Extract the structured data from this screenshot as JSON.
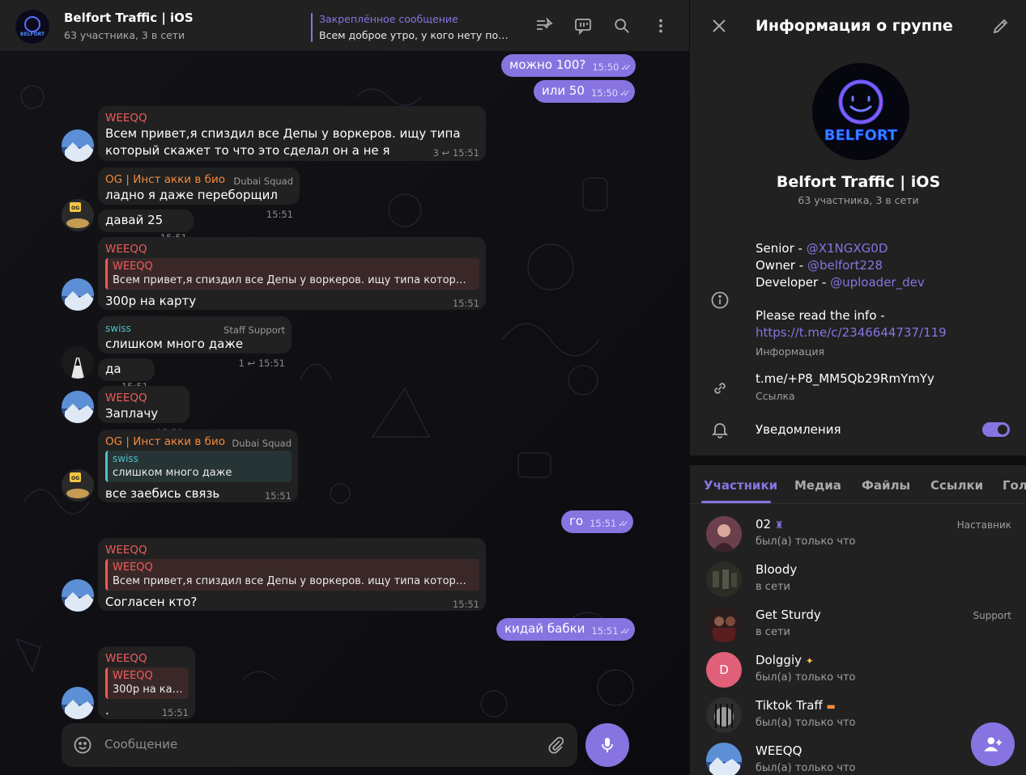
{
  "chat": {
    "title": "Belfort Traffic | iOS",
    "subtitle": "63 участника, 3 в сети",
    "pinned_label": "Закреплённое сообщение",
    "pinned_text": "Всем доброе утро, у кого нету подп...",
    "composer_placeholder": "Сообщение"
  },
  "messages": [
    {
      "text": "можно 100?",
      "time": "15:50"
    },
    {
      "text": "или 50",
      "time": "15:50"
    },
    {
      "sender": "WEEQQ",
      "text1": "Всем привет,я спиздил все Депы у воркеров. ищу типа",
      "text2": "который скажет то что это сделал он а не я",
      "replies": "3",
      "time": "15:51"
    },
    {
      "sender": "OG | Инст акки в био",
      "tag": "Dubai Squad",
      "text": "ладно я даже переборщил",
      "time": "15:51"
    },
    {
      "text": "давай 25",
      "time": "15:51"
    },
    {
      "sender": "WEEQQ",
      "reply_name": "WEEQQ",
      "reply_text": "Всем привет,я спиздил все Депы у воркеров. ищу типа который ск...",
      "text": "300р на карту",
      "time": "15:51"
    },
    {
      "sender": "swiss",
      "tag": "Staff Support",
      "text": "слишком много даже",
      "replies": "1",
      "time": "15:51"
    },
    {
      "text": "да",
      "time": "15:51"
    },
    {
      "sender": "WEEQQ",
      "text": "Заплачу",
      "time": "15:51"
    },
    {
      "sender": "OG | Инст акки в био",
      "tag": "Dubai Squad",
      "reply_name": "swiss",
      "reply_text": "слишком много даже",
      "text": "все заебись связь",
      "time": "15:51"
    },
    {
      "text": "го",
      "time": "15:51"
    },
    {
      "sender": "WEEQQ",
      "reply_name": "WEEQQ",
      "reply_text": "Всем привет,я спиздил все Депы у воркеров. ищу типа который ск...",
      "text": "Согласен кто?",
      "time": "15:51"
    },
    {
      "text": "кидай бабки",
      "time": "15:51"
    },
    {
      "sender": "WEEQQ",
      "reply_name": "WEEQQ",
      "reply_text": "300р на карту",
      "text": ".",
      "time": "15:51"
    }
  ],
  "info": {
    "title": "Информация о группе",
    "group_name": "Belfort Traffic | iOS",
    "group_sub": "63 участника, 3 в сети",
    "avatar_text": "BELFORT",
    "senior_label": "Senior - ",
    "senior_link": "@X1NGXG0D",
    "owner_label": "Owner - ",
    "owner_link": "@belfort228",
    "dev_label": "Developer - ",
    "dev_link": "@uploader_dev",
    "please": "Please read the info -",
    "info_link": "https://t.me/c/2346644737/119",
    "info_caption": "Информация",
    "invite": "t.me/+P8_MM5Qb29RmYmYy",
    "invite_caption": "Ссылка",
    "notifications": "Уведомления",
    "notifications_on": true
  },
  "tabs": [
    "Участники",
    "Медиа",
    "Файлы",
    "Ссылки",
    "Голо"
  ],
  "members": [
    {
      "name": "02",
      "status": "был(а) только что",
      "role": "Наставник",
      "color": "#7a4a5a"
    },
    {
      "name": "Bloody",
      "status": "в сети",
      "role": "",
      "color": "#3a3a30"
    },
    {
      "name": "Get Sturdy",
      "status": "в сети",
      "role": "Support",
      "color": "#3a2626"
    },
    {
      "name": "Dolggiy",
      "status": "был(а) только что",
      "role": "",
      "initial": "D",
      "color": "#e0607a"
    },
    {
      "name": "Tiktok Traff",
      "status": "был(а) только что",
      "role": "",
      "color": "#555"
    },
    {
      "name": "WEEQQ",
      "status": "был(а) только что",
      "role": "",
      "color": "#2f6bb0"
    }
  ],
  "colors": {
    "accent": "#8774e1",
    "panel": "#212121",
    "weeqq_name": "#ef5b5b",
    "og_name": "#f48a3c",
    "swiss_name": "#4fc0c8"
  }
}
